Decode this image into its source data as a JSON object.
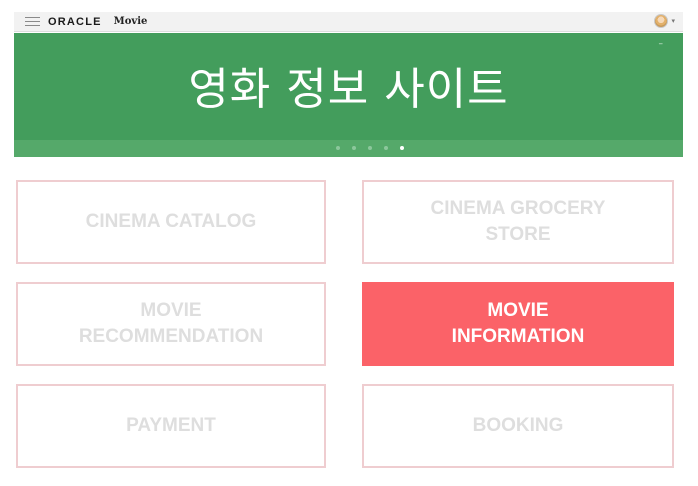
{
  "header": {
    "brand": "ORACLE",
    "app_title": "Movie",
    "icons": {
      "menu": "hamburger-menu-icon",
      "avatar": "user-avatar",
      "dropdown": "chevron-down-icon"
    }
  },
  "banner": {
    "title": "영화 정보 사이트",
    "corner_text": "–",
    "carousel_count": 5,
    "active_slide": 5,
    "color": "#439d5c"
  },
  "tiles": [
    {
      "lines": [
        "CINEMA CATALOG"
      ],
      "active": false
    },
    {
      "lines": [
        "CINEMA GROCERY",
        "STORE"
      ],
      "active": false
    },
    {
      "lines": [
        "MOVIE",
        "RECOMMENDATION"
      ],
      "active": false
    },
    {
      "lines": [
        "MOVIE",
        "INFORMATION"
      ],
      "active": true
    },
    {
      "lines": [
        "PAYMENT"
      ],
      "active": false
    },
    {
      "lines": [
        "BOOKING"
      ],
      "active": false
    }
  ],
  "colors": {
    "accent": "#fb6268",
    "tile_border": "#efcdd0",
    "tile_text": "#dedede"
  }
}
